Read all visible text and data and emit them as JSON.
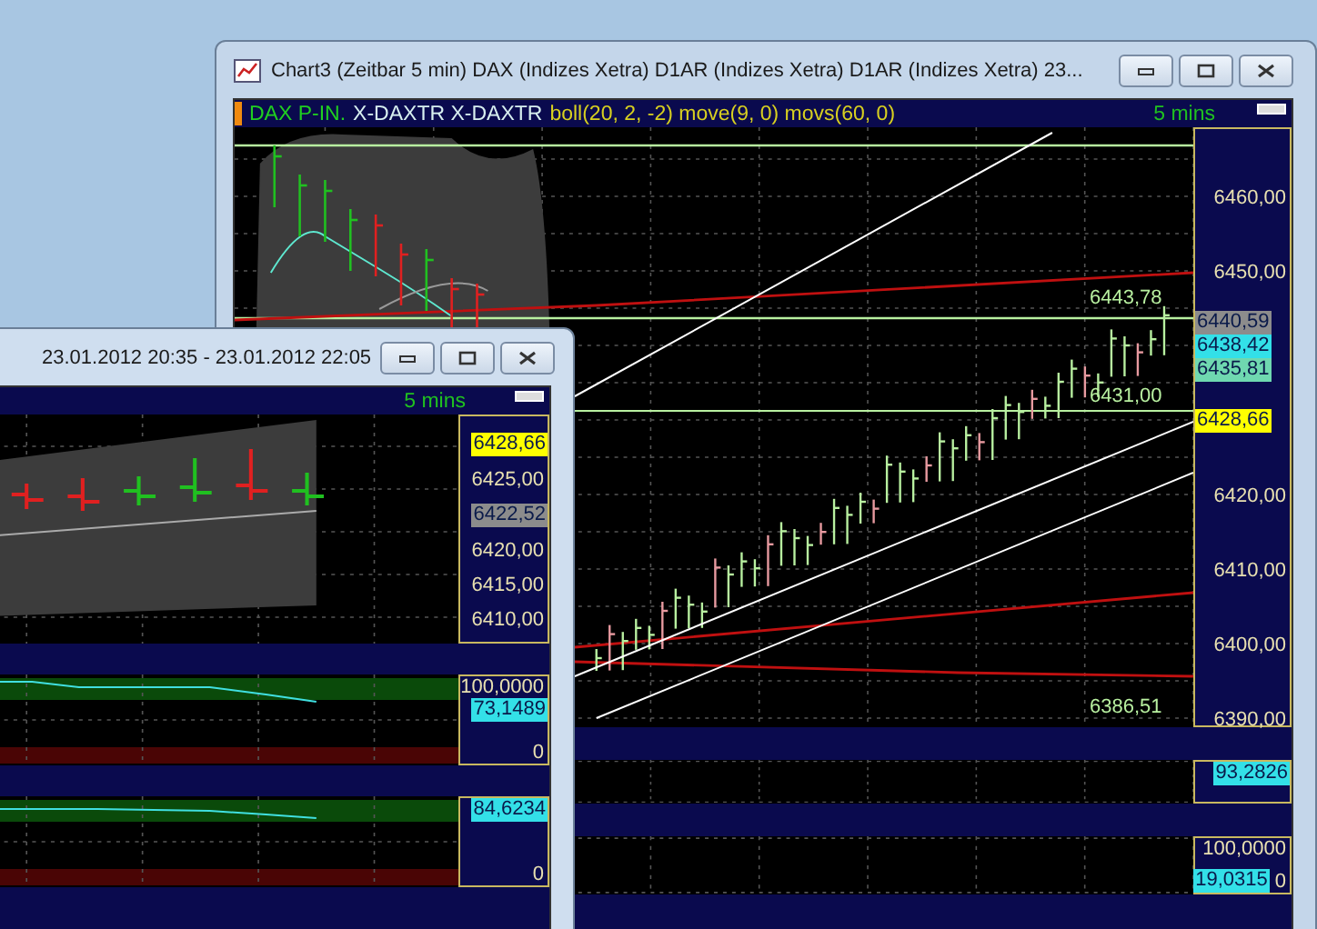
{
  "back_window": {
    "title": "Chart3 (Zeitbar 5 min)  DAX (Indizes Xetra) D1AR (Indizes Xetra) D1AR (Indizes Xetra) 23...",
    "legend": {
      "symbol": "DAX P-IN.",
      "instrument": "X-DAXTR X-DAXTR",
      "indicators": "boll(20, 2, -2) move(9, 0) movs(60, 0)",
      "interval": "5 mins"
    },
    "annotations": [
      "6443,78",
      "6431,00",
      "6386,51"
    ],
    "axis": [
      {
        "kind": "label",
        "text": "6460,00"
      },
      {
        "kind": "label",
        "text": "6450,00"
      },
      {
        "kind": "tags",
        "tags": [
          {
            "text": "6440,59",
            "color": "#8c8c8c"
          },
          {
            "text": "6438,42",
            "color": "#33e0e8"
          },
          {
            "text": "6435,81",
            "color": "#6fd8b0"
          }
        ]
      },
      {
        "kind": "tags",
        "tags": [
          {
            "text": "6428,66",
            "color": "#ffff00"
          }
        ]
      },
      {
        "kind": "label",
        "text": "6420,00"
      },
      {
        "kind": "label",
        "text": "6410,00"
      },
      {
        "kind": "label",
        "text": "6400,00"
      },
      {
        "kind": "label",
        "text": "6390,00"
      }
    ],
    "panes": [
      {
        "top": [
          {
            "kind": "tag",
            "text": "93,2826",
            "color": "#33e0e8"
          }
        ]
      },
      {
        "top": [
          {
            "kind": "label",
            "text": "100,0000"
          }
        ],
        "bottom": [
          {
            "kind": "tag",
            "text": "19,0315",
            "color": "#33e0e8"
          },
          {
            "kind": "label",
            "text": "0"
          }
        ]
      }
    ]
  },
  "front_window": {
    "title": "23.01.2012 20:35 - 23.01.2012 22:05",
    "interval": "5 mins",
    "axis": [
      {
        "kind": "tags",
        "tags": [
          {
            "text": "6428,66",
            "color": "#ffff00"
          }
        ]
      },
      {
        "kind": "label",
        "text": "6425,00"
      },
      {
        "kind": "tags",
        "tags": [
          {
            "text": "6422,52",
            "color": "#8c8c8c"
          }
        ]
      },
      {
        "kind": "label",
        "text": "6420,00"
      },
      {
        "kind": "label",
        "text": "6415,00"
      },
      {
        "kind": "label",
        "text": "6410,00"
      }
    ],
    "panes": [
      {
        "top": [
          {
            "kind": "label",
            "text": "100,0000"
          },
          {
            "kind": "tag",
            "text": "73,1489",
            "color": "#33e0e8"
          }
        ],
        "bottom": [
          {
            "kind": "label",
            "text": "0"
          }
        ]
      },
      {
        "top": [
          {
            "kind": "tag",
            "text": "84,6234",
            "color": "#33e0e8"
          }
        ],
        "bottom": [
          {
            "kind": "label",
            "text": "0"
          }
        ]
      }
    ]
  }
}
